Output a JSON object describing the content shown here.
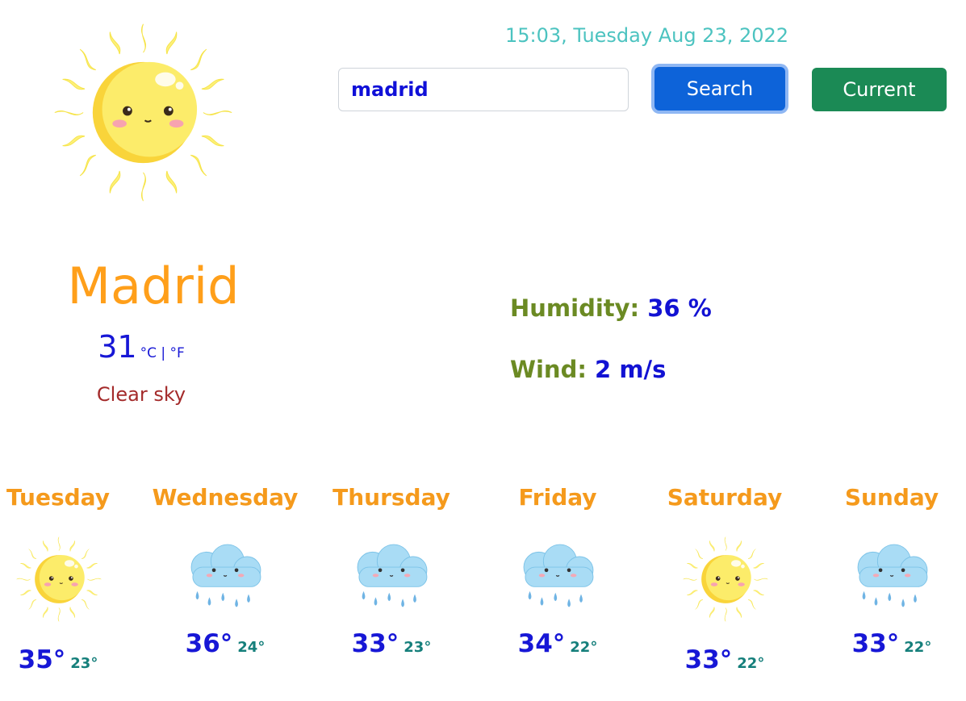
{
  "header": {
    "datetime": "15:03, Tuesday Aug 23, 2022"
  },
  "search": {
    "value": "madrid",
    "search_label": "Search",
    "current_label": "Current"
  },
  "current": {
    "icon": "sun-icon",
    "city": "Madrid",
    "temperature": "31",
    "units": "°C | °F",
    "description": "Clear sky",
    "humidity_label": "Humidity:",
    "humidity_value": "36 %",
    "wind_label": "Wind:",
    "wind_value": "2 m/s"
  },
  "forecast": [
    {
      "day": "Tuesday",
      "icon": "sun-icon",
      "max": "35°",
      "min": "23°"
    },
    {
      "day": "Wednesday",
      "icon": "rain-cloud-icon",
      "max": "36°",
      "min": "24°"
    },
    {
      "day": "Thursday",
      "icon": "rain-cloud-icon",
      "max": "33°",
      "min": "23°"
    },
    {
      "day": "Friday",
      "icon": "rain-cloud-icon",
      "max": "34°",
      "min": "22°"
    },
    {
      "day": "Saturday",
      "icon": "sun-icon",
      "max": "33°",
      "min": "22°"
    },
    {
      "day": "Sunday",
      "icon": "rain-cloud-icon",
      "max": "33°",
      "min": "22°"
    }
  ],
  "colors": {
    "city": "#ff9f1a",
    "temperature": "#1717d6",
    "description": "#a42b2b",
    "stats_label": "#6b8a23",
    "search_button": "#0d63d9",
    "current_button": "#1b8a55",
    "datetime": "#4cc3c0"
  }
}
